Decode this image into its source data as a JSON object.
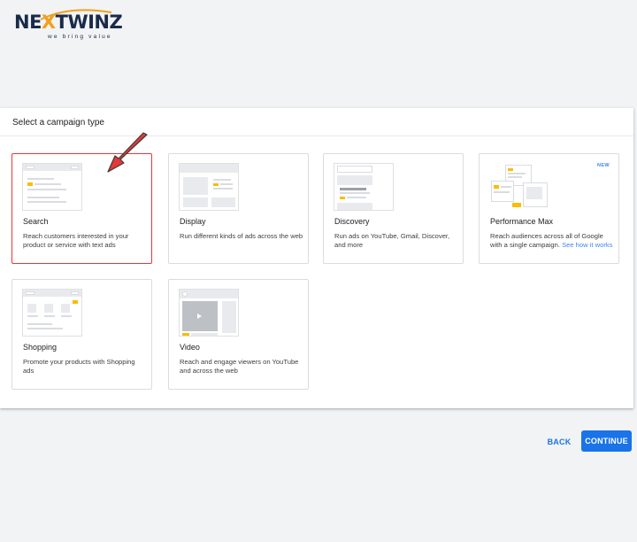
{
  "logo": {
    "name": "NEXTWINZ",
    "name_before_x": "NE",
    "name_x": "X",
    "name_after_x": "TWINZ",
    "tagline": "we bring value"
  },
  "panel": {
    "title": "Select a campaign type"
  },
  "cards": [
    {
      "title": "Search",
      "desc": "Reach customers interested in your product or service with text ads",
      "selected": true
    },
    {
      "title": "Display",
      "desc": "Run different kinds of ads across the web",
      "selected": false
    },
    {
      "title": "Discovery",
      "desc": "Run ads on YouTube, Gmail, Discover, and more",
      "selected": false
    },
    {
      "title": "Performance Max",
      "badge": "NEW",
      "desc": "Reach audiences across all of Google with a single campaign.",
      "link": "See how it works",
      "selected": false
    },
    {
      "title": "Shopping",
      "desc": "Promote your products with Shopping ads",
      "selected": false
    },
    {
      "title": "Video",
      "desc": "Reach and engage viewers on YouTube and across the web",
      "selected": false
    }
  ],
  "annotation": {
    "arrow_color": "#e53935"
  },
  "buttons": {
    "back": "BACK",
    "continue": "CONTINUE"
  },
  "colors": {
    "accent": "#1a73e8",
    "highlight": "#fbbc04",
    "selected_border": "#e53935"
  },
  "icons": [
    "play-icon"
  ]
}
